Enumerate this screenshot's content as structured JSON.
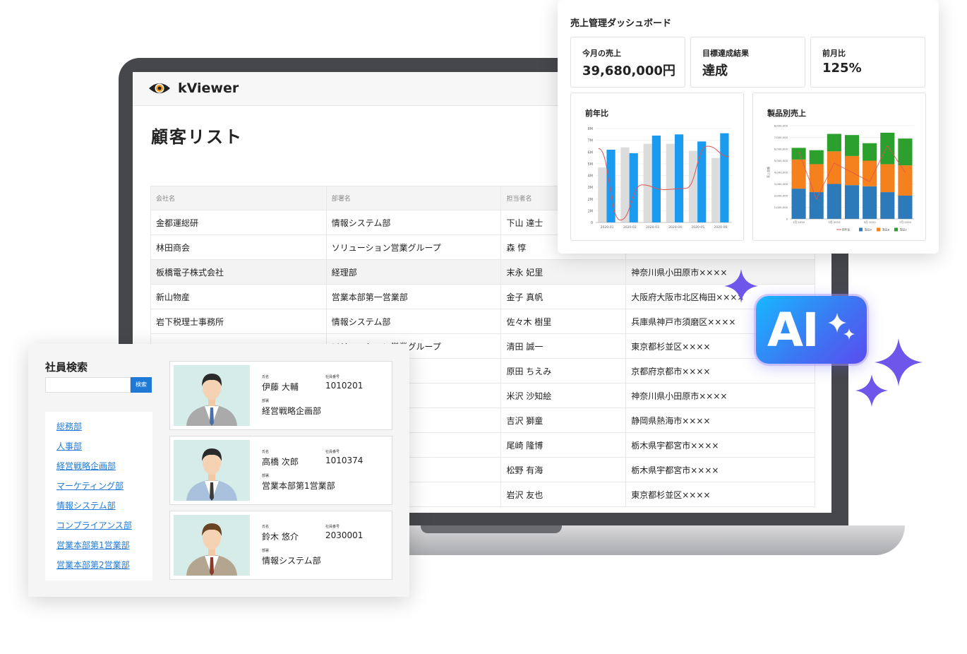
{
  "app": {
    "name": "kViewer"
  },
  "customer_list": {
    "title": "顧客リスト",
    "headers": [
      "会社名",
      "部署名",
      "担当者名",
      ""
    ],
    "rows": [
      [
        "金都運総研",
        "情報システム部",
        "下山 達士",
        ""
      ],
      [
        "林田商会",
        "ソリューション営業グループ",
        "森 惇",
        ""
      ],
      [
        "板橋電子株式会社",
        "経理部",
        "末永 妃里",
        "神奈川県小田原市××××"
      ],
      [
        "新山物産",
        "営業本部第一営業部",
        "金子 真帆",
        "大阪府大阪市北区梅田××××"
      ],
      [
        "岩下税理士事務所",
        "情報システム部",
        "佐々木 樹里",
        "兵庫県神戸市須磨区××××"
      ],
      [
        "",
        "ソリューション営業グループ",
        "清田 誠一",
        "東京都杉並区××××"
      ],
      [
        "",
        "",
        "原田 ちえみ",
        "京都府京都市××××"
      ],
      [
        "",
        "",
        "米沢 沙知絵",
        "神奈川県小田原市××××"
      ],
      [
        "",
        "",
        "吉沢 獅童",
        "静岡県熱海市××××"
      ],
      [
        "",
        "",
        "尾崎 隆博",
        "栃木県宇都宮市××××"
      ],
      [
        "",
        "",
        "松野 有海",
        "栃木県宇都宮市××××"
      ],
      [
        "",
        "",
        "岩沢 友也",
        "東京都杉並区××××"
      ]
    ]
  },
  "dashboard": {
    "title": "売上管理ダッシュボード",
    "kpis": [
      {
        "label": "今月の売上",
        "value": "39,680,000円"
      },
      {
        "label": "目標達成結果",
        "value": "達成"
      },
      {
        "label": "前月比",
        "value": "125%"
      }
    ]
  },
  "chart_data": [
    {
      "type": "bar",
      "title": "前年比",
      "categories": [
        "2020-01",
        "2020-02",
        "2020-03",
        "2020-04",
        "2020-05",
        "2020-06"
      ],
      "y_ticks": [
        "0",
        "1M",
        "2M",
        "3M",
        "4M",
        "5M",
        "6M",
        "7M",
        "8M"
      ],
      "ylim": [
        0,
        8000000
      ],
      "series": [
        {
          "values": [
            4700000,
            6400000,
            6700000,
            6700000,
            6100000,
            5500000
          ],
          "color": "#dcdcdc"
        },
        {
          "values": [
            6200000,
            5900000,
            7400000,
            7500000,
            6900000,
            7600000
          ],
          "color": "#1a9bf0"
        }
      ],
      "line": {
        "values": [
          6300000,
          200000,
          3200000,
          2800000,
          2900000,
          6500000,
          5600000
        ],
        "color": "#e0524f"
      }
    },
    {
      "type": "bar",
      "title": "製品別売上",
      "categories": [
        "1月 2020",
        "",
        "3月 2020",
        "",
        "5月 2020",
        "",
        "7月 2020"
      ],
      "y_ticks": [
        "0",
        "1,000,000",
        "2,000,000",
        "3,000,000",
        "4,000,000",
        "5,000,000",
        "6,000,000",
        "7,000,000",
        "8,000,000"
      ],
      "ylim": [
        0,
        8000000
      ],
      "ylabel": "売上金額",
      "stacked": true,
      "series": [
        {
          "name": "製品A",
          "color": "#2c7ab9",
          "values": [
            2600000,
            2300000,
            3000000,
            2900000,
            2800000,
            2300000,
            2000000
          ]
        },
        {
          "name": "製品B",
          "color": "#f5801e",
          "values": [
            2500000,
            2400000,
            2800000,
            2500000,
            2200000,
            2400000,
            2600000
          ]
        },
        {
          "name": "製品C",
          "color": "#2ca02c",
          "values": [
            1000000,
            1200000,
            1500000,
            1800000,
            1500000,
            2700000,
            2300000
          ]
        }
      ],
      "line": {
        "name": "前年比",
        "color": "#e0524f",
        "values": [
          5800000,
          1700000,
          4800000,
          4000000,
          3200000,
          6300000,
          4000000
        ]
      },
      "legend": [
        "前年比",
        "製品A",
        "製品B",
        "製品C"
      ]
    }
  ],
  "ai_badge": {
    "text": "AI"
  },
  "employee_search": {
    "title": "社員検索",
    "search_button": "検索",
    "departments": [
      "総務部",
      "人事部",
      "経営戦略企画部",
      "マーケティング部",
      "情報システム部",
      "コンプライアンス部",
      "営業本部第1営業部",
      "営業本部第2営業部"
    ],
    "field_labels": {
      "name": "氏名",
      "id": "社員番号",
      "dept": "部署"
    },
    "employees": [
      {
        "name": "伊藤 大輔",
        "id": "1010201",
        "dept": "経営戦略企画部",
        "hair": "#2a2a2a",
        "suit": "#aaaaaa",
        "tie": "#4a6fa5"
      },
      {
        "name": "高橋 次郎",
        "id": "1010374",
        "dept": "営業本部第1営業部",
        "hair": "#2a2a2a",
        "suit": "#a9c1dc",
        "tie": "#3b3b3b"
      },
      {
        "name": "鈴木 悠介",
        "id": "2030001",
        "dept": "情報システム部",
        "hair": "#6a4422",
        "suit": "#b3a590",
        "tie": "#8a3a2a"
      }
    ]
  }
}
